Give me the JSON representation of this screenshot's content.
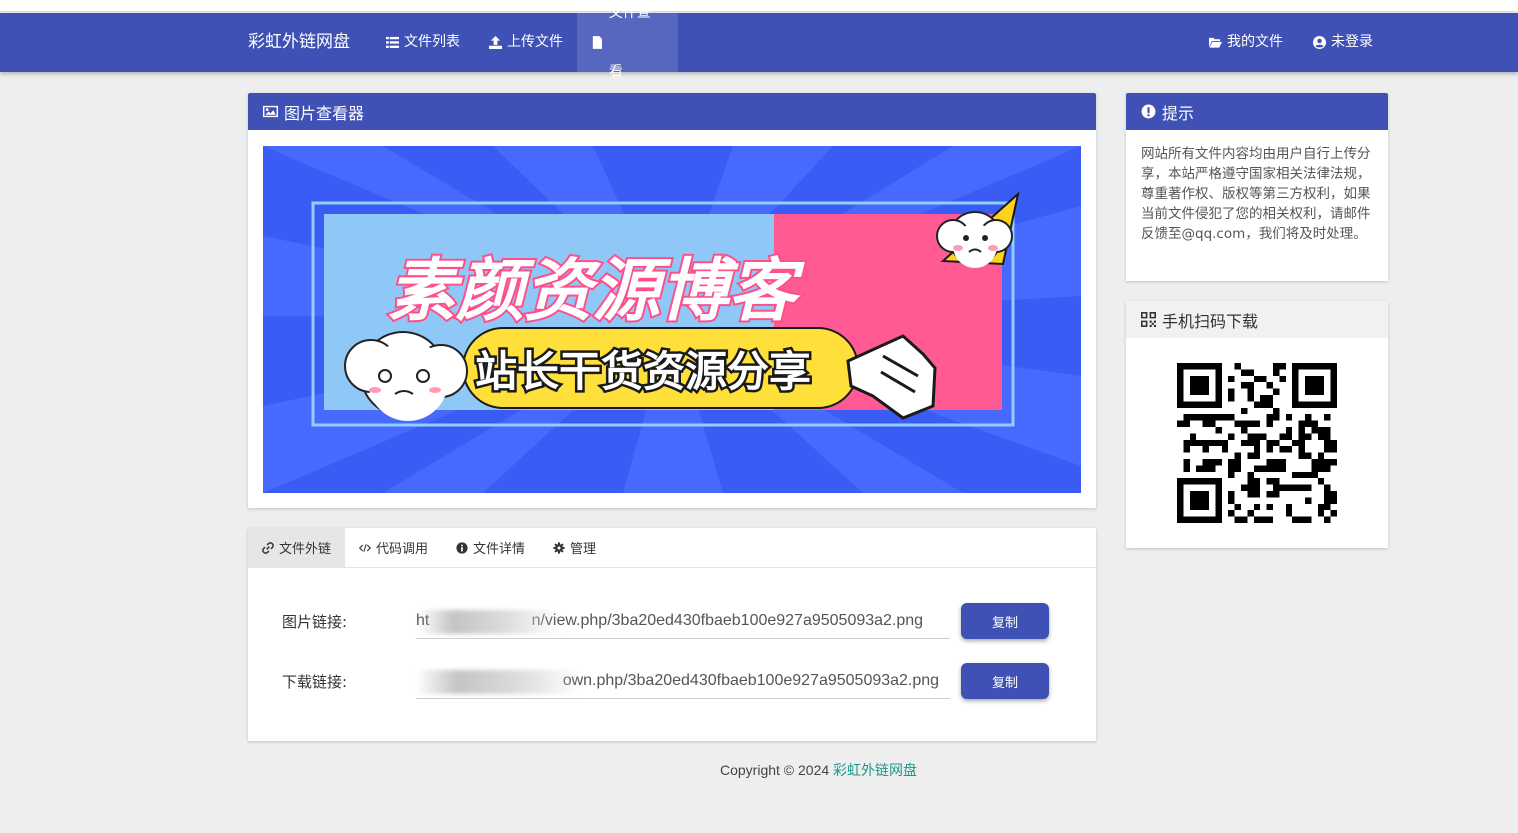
{
  "nav": {
    "brand": "彩虹外链网盘",
    "items": [
      {
        "label": "文件列表",
        "icon": "list-icon"
      },
      {
        "label": "上传文件",
        "icon": "upload-icon"
      },
      {
        "label": "文件查看",
        "icon": "file-icon"
      }
    ],
    "right": [
      {
        "label": "我的文件",
        "icon": "folder-open-icon"
      },
      {
        "label": "未登录",
        "icon": "user-circle-icon"
      }
    ],
    "active": "文件查看"
  },
  "viewer": {
    "title": "图片查看器",
    "banner_title": "素颜资源博客",
    "banner_subtitle": "站长干货资源分享"
  },
  "tabs": [
    {
      "label": "文件外链",
      "icon": "link-icon"
    },
    {
      "label": "代码调用",
      "icon": "code-icon"
    },
    {
      "label": "文件详情",
      "icon": "info-icon"
    },
    {
      "label": "管理",
      "icon": "gear-icon"
    }
  ],
  "links": {
    "image_label": "图片链接:",
    "image_value": "ht                       n/view.php/3ba20ed430fbaeb100e927a9505093a2.png",
    "download_label": "下载链接:",
    "download_value": "                                 own.php/3ba20ed430fbaeb100e927a9505093a2.png",
    "copy_label": "复制"
  },
  "notice": {
    "title": "提示",
    "text": "网站所有文件内容均由用户自行上传分享，本站严格遵守国家相关法律法规，尊重著作权、版权等第三方权利，如果当前文件侵犯了您的相关权利，请邮件反馈至@qq.com，我们将及时处理。"
  },
  "qr": {
    "title": "手机扫码下载"
  },
  "footer": {
    "copyright": "Copyright © 2024",
    "site": "彩虹外链网盘"
  },
  "colors": {
    "primary": "#3f51b5",
    "background": "#eeeeee",
    "banner_blue": "#3a5cf5",
    "banner_pink": "#ff5a93",
    "banner_yellow": "#ffe03a"
  }
}
